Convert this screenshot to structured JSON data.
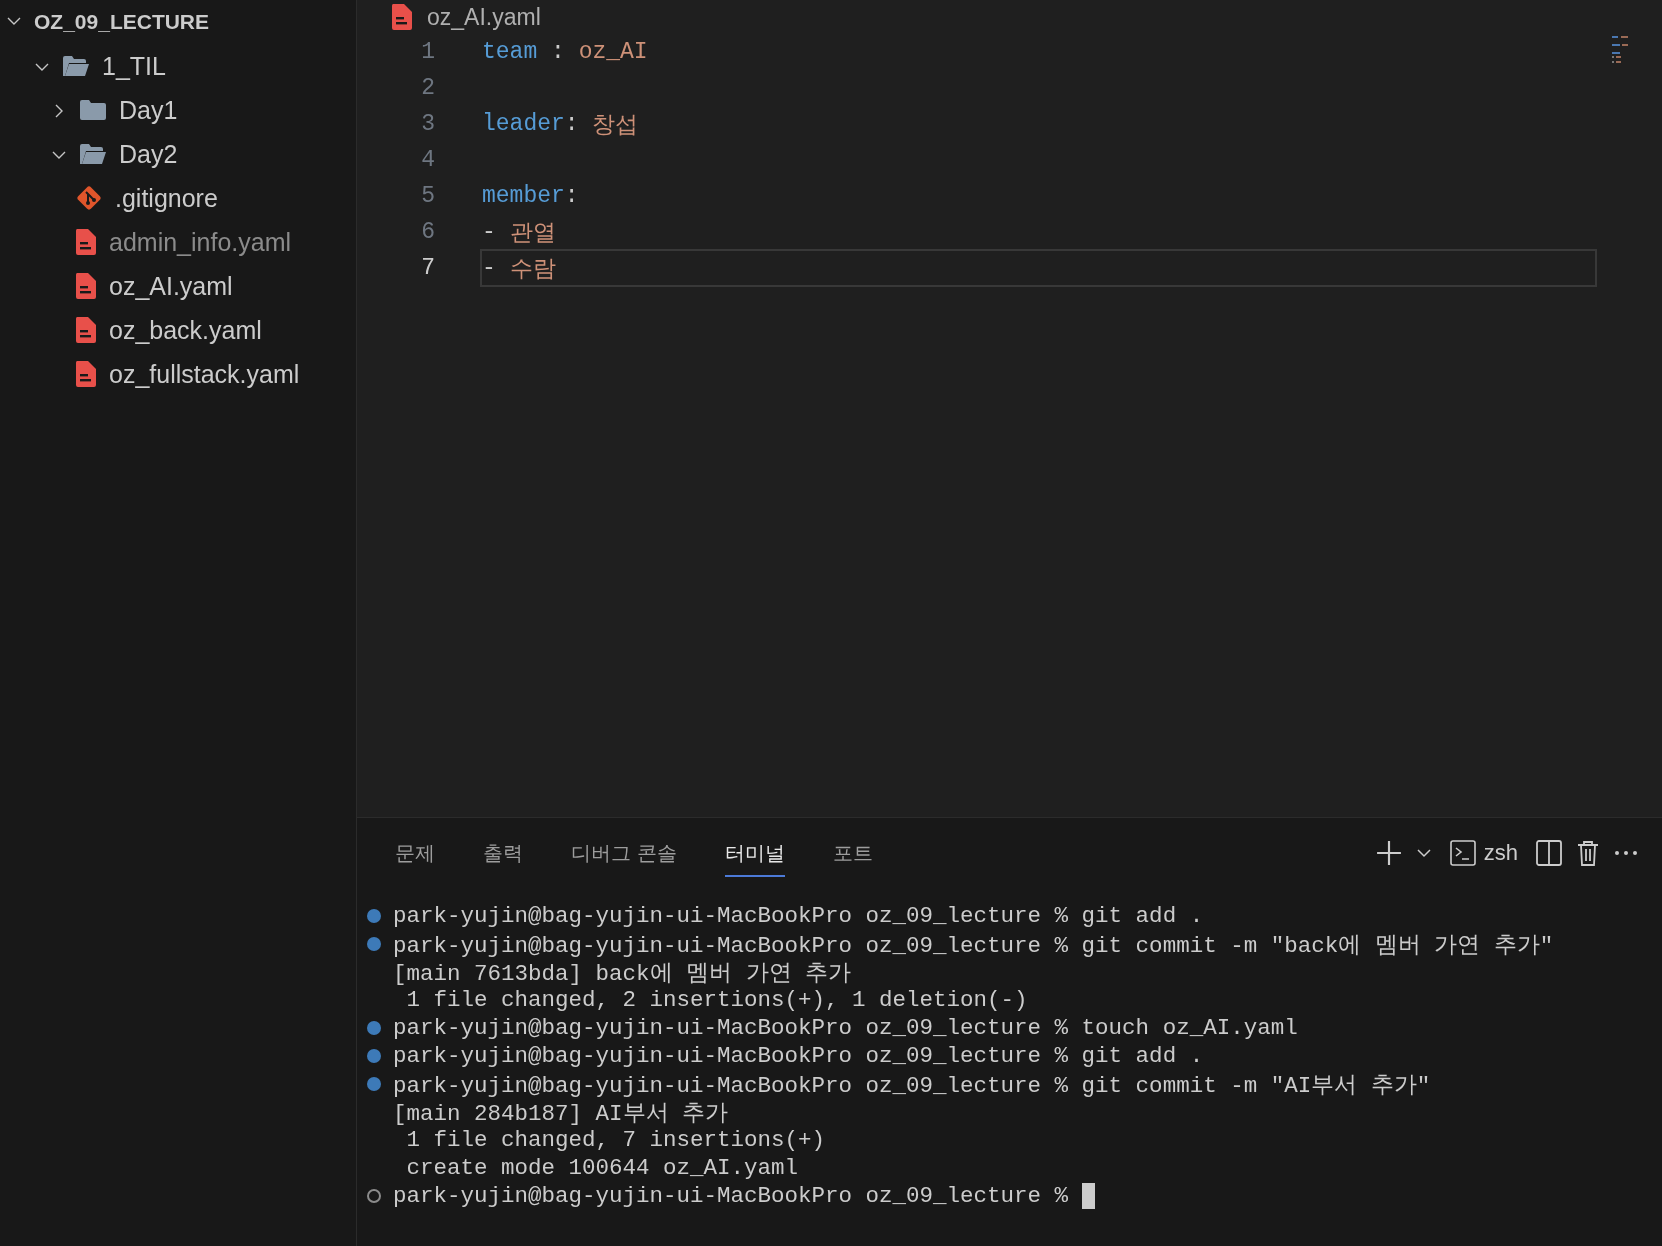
{
  "explorer": {
    "title": "OZ_09_LECTURE",
    "expanded": true,
    "tree": [
      {
        "name": "1_TIL",
        "kind": "folder",
        "expanded": true,
        "children": [
          {
            "name": "Day1",
            "kind": "folder",
            "expanded": false
          },
          {
            "name": "Day2",
            "kind": "folder",
            "expanded": true
          },
          {
            "name": ".gitignore",
            "kind": "git-file",
            "dimmed": false
          },
          {
            "name": "admin_info.yaml",
            "kind": "yaml-file",
            "dimmed": true
          },
          {
            "name": "oz_AI.yaml",
            "kind": "yaml-file",
            "dimmed": false
          },
          {
            "name": "oz_back.yaml",
            "kind": "yaml-file",
            "dimmed": false
          },
          {
            "name": "oz_fullstack.yaml",
            "kind": "yaml-file",
            "dimmed": false
          }
        ]
      }
    ]
  },
  "editor": {
    "file": "oz_AI.yaml",
    "lines": [
      {
        "number": "1",
        "current": false,
        "tokens": [
          {
            "text": "team",
            "kind": "key"
          },
          {
            "text": " : ",
            "kind": "punct"
          },
          {
            "text": "oz_AI",
            "kind": "value"
          }
        ]
      },
      {
        "number": "2",
        "current": false
      },
      {
        "number": "3",
        "current": false,
        "tokens": [
          {
            "text": "leader",
            "kind": "key"
          },
          {
            "text": ": ",
            "kind": "punct"
          },
          {
            "text": "창섭",
            "kind": "value"
          }
        ]
      },
      {
        "number": "4",
        "current": false
      },
      {
        "number": "5",
        "current": false,
        "tokens": [
          {
            "text": "member",
            "kind": "key"
          },
          {
            "text": ":",
            "kind": "punct"
          }
        ]
      },
      {
        "number": "6",
        "current": false,
        "tokens": [
          {
            "text": "- ",
            "kind": "punct"
          },
          {
            "text": "관열",
            "kind": "value"
          }
        ]
      },
      {
        "number": "7",
        "current": true,
        "tokens": [
          {
            "text": "- ",
            "kind": "punct"
          },
          {
            "text": "수람",
            "kind": "value"
          }
        ]
      }
    ]
  },
  "panel": {
    "tabs": [
      {
        "label": "문제",
        "selected": false
      },
      {
        "label": "출력",
        "selected": false
      },
      {
        "label": "디버그 콘솔",
        "selected": false
      },
      {
        "label": "터미널",
        "selected": true
      },
      {
        "label": "포트",
        "selected": false
      }
    ],
    "shell": "zsh",
    "terminal": [
      {
        "kind": "command",
        "text": "park-yujin@bag-yujin-ui-MacBookPro oz_09_lecture % git add ."
      },
      {
        "kind": "command",
        "text": "park-yujin@bag-yujin-ui-MacBookPro oz_09_lecture % git commit -m \"back에 멤버 가연 추가\""
      },
      {
        "kind": "output",
        "text": "[main 7613bda] back에 멤버 가연 추가"
      },
      {
        "kind": "output",
        "text": " 1 file changed, 2 insertions(+), 1 deletion(-)"
      },
      {
        "kind": "command",
        "text": "park-yujin@bag-yujin-ui-MacBookPro oz_09_lecture % touch oz_AI.yaml"
      },
      {
        "kind": "command",
        "text": "park-yujin@bag-yujin-ui-MacBookPro oz_09_lecture % git add ."
      },
      {
        "kind": "command",
        "text": "park-yujin@bag-yujin-ui-MacBookPro oz_09_lecture % git commit -m \"AI부서 추가\""
      },
      {
        "kind": "output",
        "text": "[main 284b187] AI부서 추가"
      },
      {
        "kind": "output",
        "text": " 1 file changed, 7 insertions(+)"
      },
      {
        "kind": "output",
        "text": " create mode 100644 oz_AI.yaml"
      },
      {
        "kind": "prompt",
        "text": "park-yujin@bag-yujin-ui-MacBookPro oz_09_lecture % "
      }
    ]
  }
}
